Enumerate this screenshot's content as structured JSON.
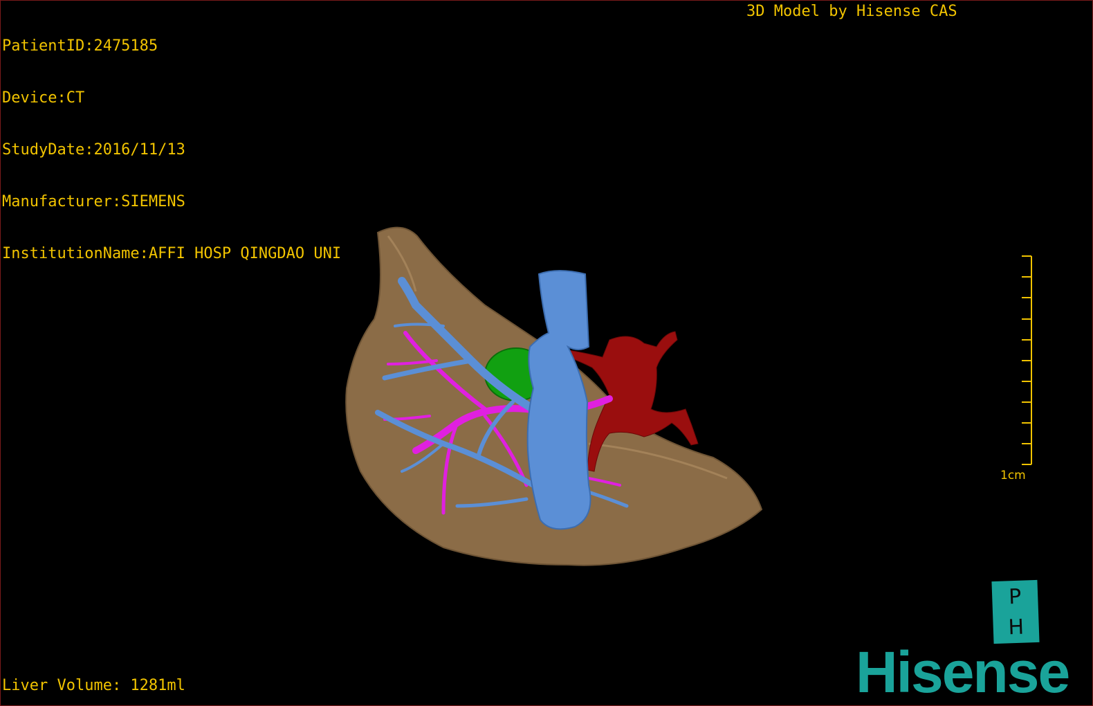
{
  "overlay": {
    "patient_id": "PatientID:2475185",
    "device": "Device:CT",
    "study_date": "StudyDate:2016/11/13",
    "manufacturer": "Manufacturer:SIEMENS",
    "institution": "InstitutionName:AFFI HOSP QINGDAO UNI",
    "model_credit": "3D Model by Hisense CAS",
    "liver_volume": "Liver Volume: 1281ml"
  },
  "scale_bar": {
    "label": "1cm"
  },
  "badge": {
    "top": "P",
    "bottom": "H"
  },
  "logo": {
    "text": "Hisense"
  },
  "colors": {
    "overlay_text": "#f2c400",
    "liver": "#8b6c47",
    "portal_vein": "#5b8fd6",
    "hepatic_vein": "#e020e0",
    "artery": "#9a0e0e",
    "tumor": "#11a011",
    "brand": "#1aa39a"
  }
}
